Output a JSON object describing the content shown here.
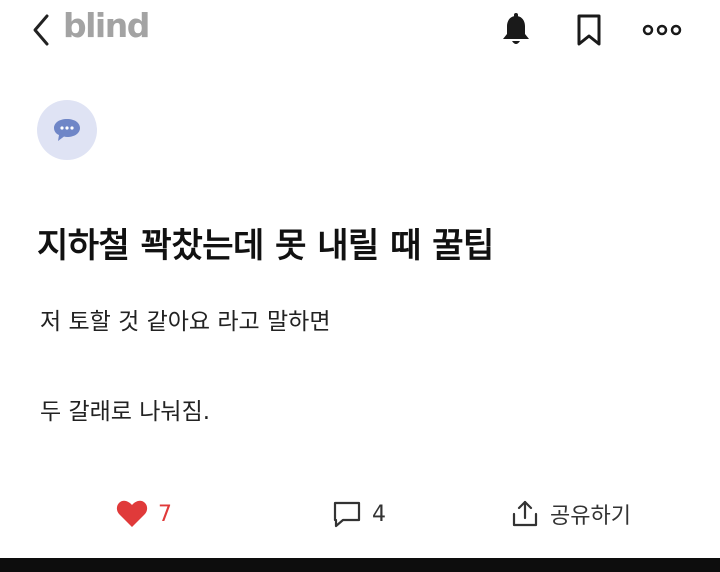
{
  "app": {
    "logo_text": "blind"
  },
  "topbar": {
    "icons": {
      "back": "chevron-left-icon",
      "notify": "bell-icon",
      "bookmark": "bookmark-icon",
      "more": "more-horizontal-icon"
    }
  },
  "author": {
    "avatar_icon": "chat-bubble-icon",
    "avatar_color": "#dfe3f4",
    "icon_color": "#6f86c7"
  },
  "post": {
    "title": "지하철 꽉찼는데 못 내릴 때 꿀팁",
    "body_lines": [
      "저 토할 것 같아요 라고 말하면",
      "두 갈래로 나눠짐."
    ]
  },
  "actions": {
    "likes": {
      "icon": "heart-icon",
      "count": "7",
      "color": "#e03a3a"
    },
    "comments": {
      "icon": "comment-icon",
      "count": "4"
    },
    "share": {
      "icon": "share-icon",
      "label": "공유하기"
    }
  }
}
